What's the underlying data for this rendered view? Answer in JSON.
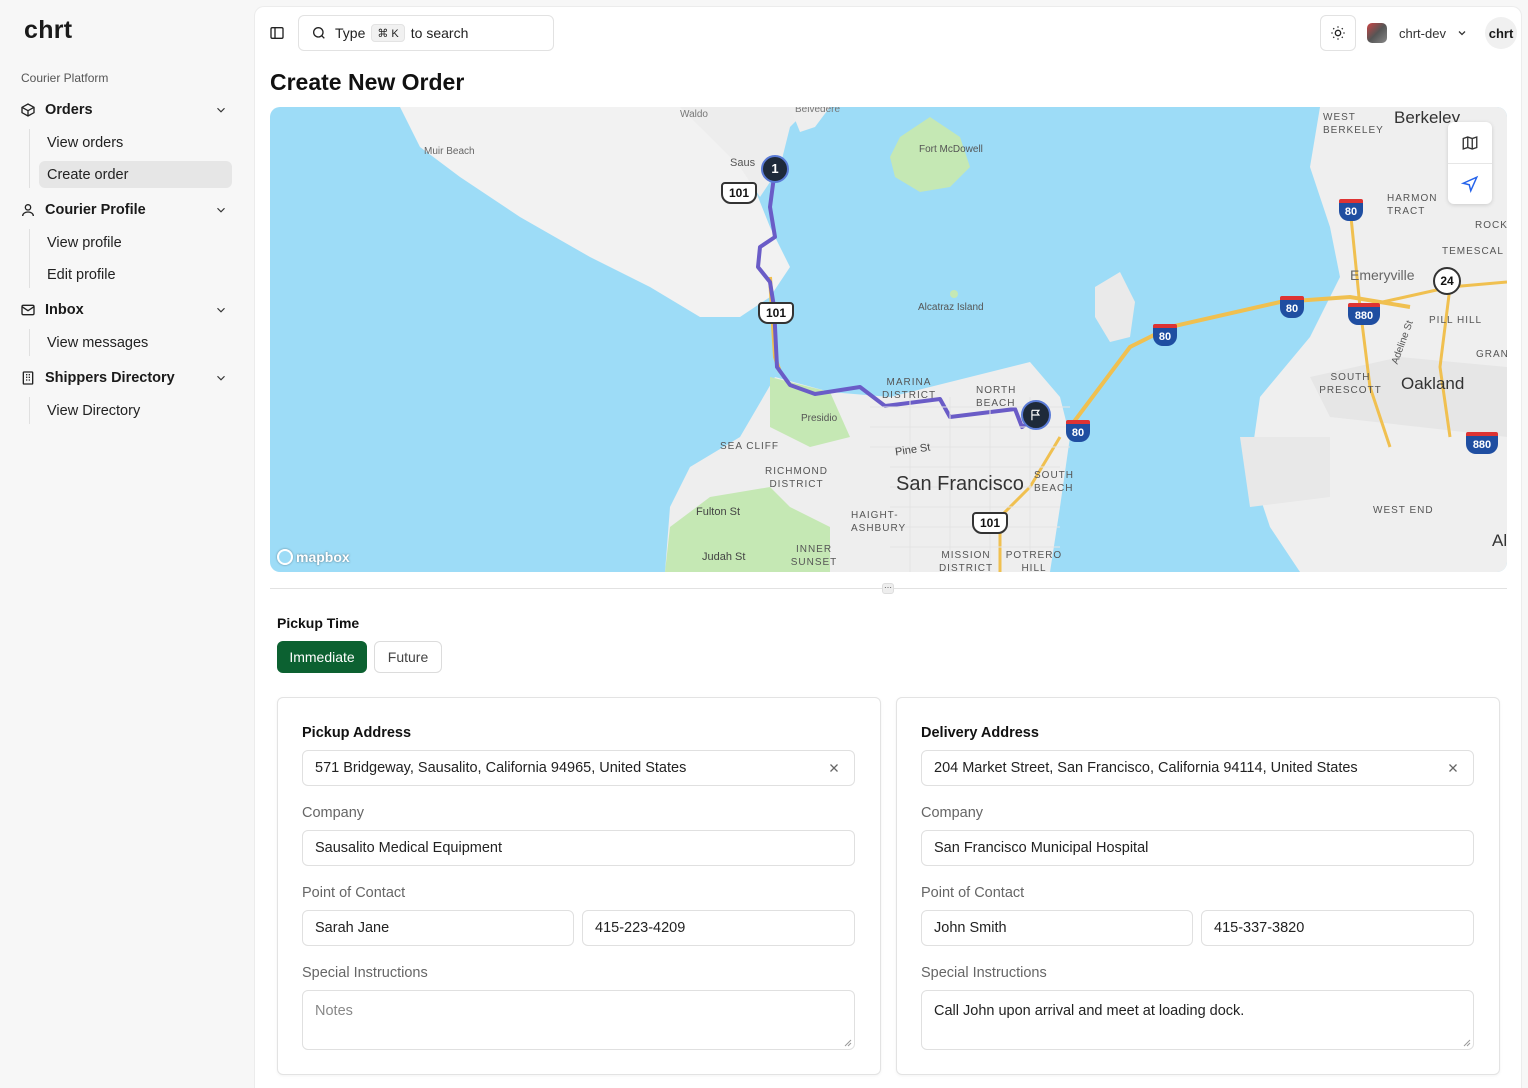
{
  "sidebar": {
    "logo": "chrt",
    "section_label": "Courier Platform",
    "groups": [
      {
        "label": "Orders",
        "icon": "package-icon",
        "items": [
          "View orders",
          "Create order"
        ],
        "active": "Create order"
      },
      {
        "label": "Courier Profile",
        "icon": "user-icon",
        "items": [
          "View profile",
          "Edit profile"
        ]
      },
      {
        "label": "Inbox",
        "icon": "mail-icon",
        "items": [
          "View messages"
        ]
      },
      {
        "label": "Shippers Directory",
        "icon": "building-icon",
        "items": [
          "View Directory"
        ]
      }
    ]
  },
  "header": {
    "search_prefix": "Type",
    "search_kbd": "⌘ K",
    "search_suffix": "to search",
    "username": "chrt-dev",
    "avatar_text": "chrt"
  },
  "page": {
    "title": "Create New Order"
  },
  "map": {
    "attribution": "mapbox",
    "route_stop_number": "1",
    "labels": [
      "Waldo",
      "Belvedere",
      "Muir Beach",
      "Fort McDowell",
      "WEST BERKELEY",
      "Berkeley",
      "HARMON TRACT",
      "TEMESCAL",
      "Emeryville",
      "ROCK",
      "Alcatraz Island",
      "PILL HILL",
      "GRAN",
      "Adeline St",
      "SOUTH PRESCOTT",
      "Oakland",
      "MARINA DISTRICT",
      "NORTH BEACH",
      "Presidio",
      "SEA CLIFF",
      "Pine St",
      "RICHMOND DISTRICT",
      "San Francisco",
      "SOUTH BEACH",
      "Fulton St",
      "HAIGHT-ASHBURY",
      "WEST END",
      "Judah St",
      "INNER SUNSET",
      "MISSION DISTRICT",
      "POTRERO HILL",
      "Saus",
      "Al"
    ],
    "shields": [
      "101",
      "101",
      "101",
      "80",
      "80",
      "80",
      "80",
      "880",
      "880",
      "24"
    ]
  },
  "pickup_time": {
    "label": "Pickup Time",
    "options": [
      "Immediate",
      "Future"
    ],
    "selected": "Immediate"
  },
  "pickup": {
    "heading": "Pickup Address",
    "address": "571 Bridgeway, Sausalito, California 94965, United States",
    "company_label": "Company",
    "company": "Sausalito Medical Equipment",
    "poc_label": "Point of Contact",
    "contact_name": "Sarah Jane",
    "contact_phone": "415-223-4209",
    "instructions_label": "Special Instructions",
    "instructions_placeholder": "Notes"
  },
  "delivery": {
    "heading": "Delivery Address",
    "address": "204 Market Street, San Francisco, California 94114, United States",
    "company_label": "Company",
    "company": "San Francisco Municipal Hospital",
    "poc_label": "Point of Contact",
    "contact_name": "John Smith",
    "contact_phone": "415-337-3820",
    "instructions_label": "Special Instructions",
    "instructions": "Call John upon arrival and meet at loading dock."
  },
  "colors": {
    "primary": "#0c6131",
    "route": "#6a5cc7",
    "water": "#9ddcf7",
    "park": "#c5e8b4"
  }
}
